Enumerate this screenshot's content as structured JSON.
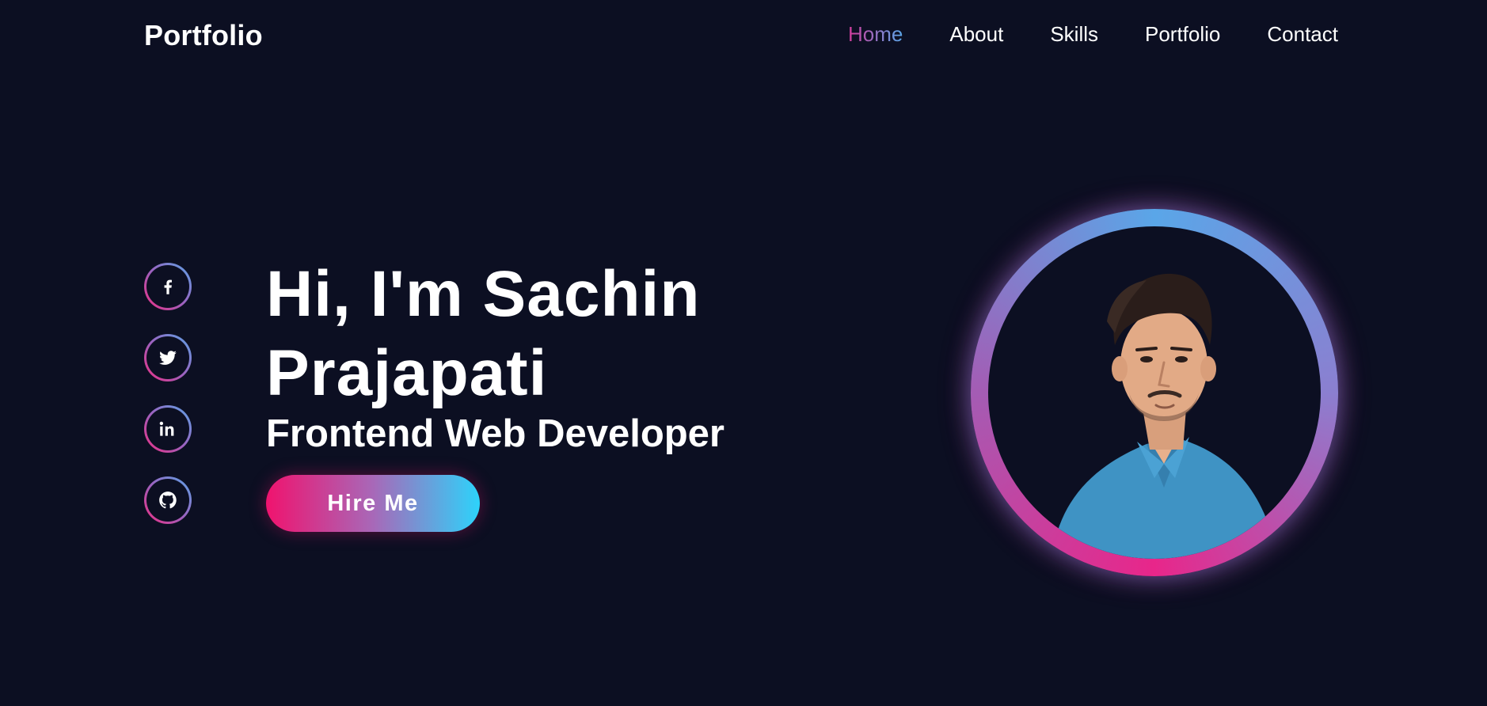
{
  "header": {
    "logo": "Portfolio",
    "nav": [
      {
        "label": "Home",
        "active": true
      },
      {
        "label": "About",
        "active": false
      },
      {
        "label": "Skills",
        "active": false
      },
      {
        "label": "Portfolio",
        "active": false
      },
      {
        "label": "Contact",
        "active": false
      }
    ]
  },
  "socials": [
    {
      "icon": "facebook-icon"
    },
    {
      "icon": "twitter-icon"
    },
    {
      "icon": "linkedin-icon"
    },
    {
      "icon": "github-icon"
    }
  ],
  "hero": {
    "title": "Hi, I'm Sachin Prajapati",
    "subtitle": "Frontend Web Developer",
    "button": "Hire Me"
  },
  "colors": {
    "background": "#0c0f22",
    "accent_pink": "#f0136e",
    "accent_blue": "#2dd3fb",
    "ring_blue": "#5aa6e8"
  }
}
